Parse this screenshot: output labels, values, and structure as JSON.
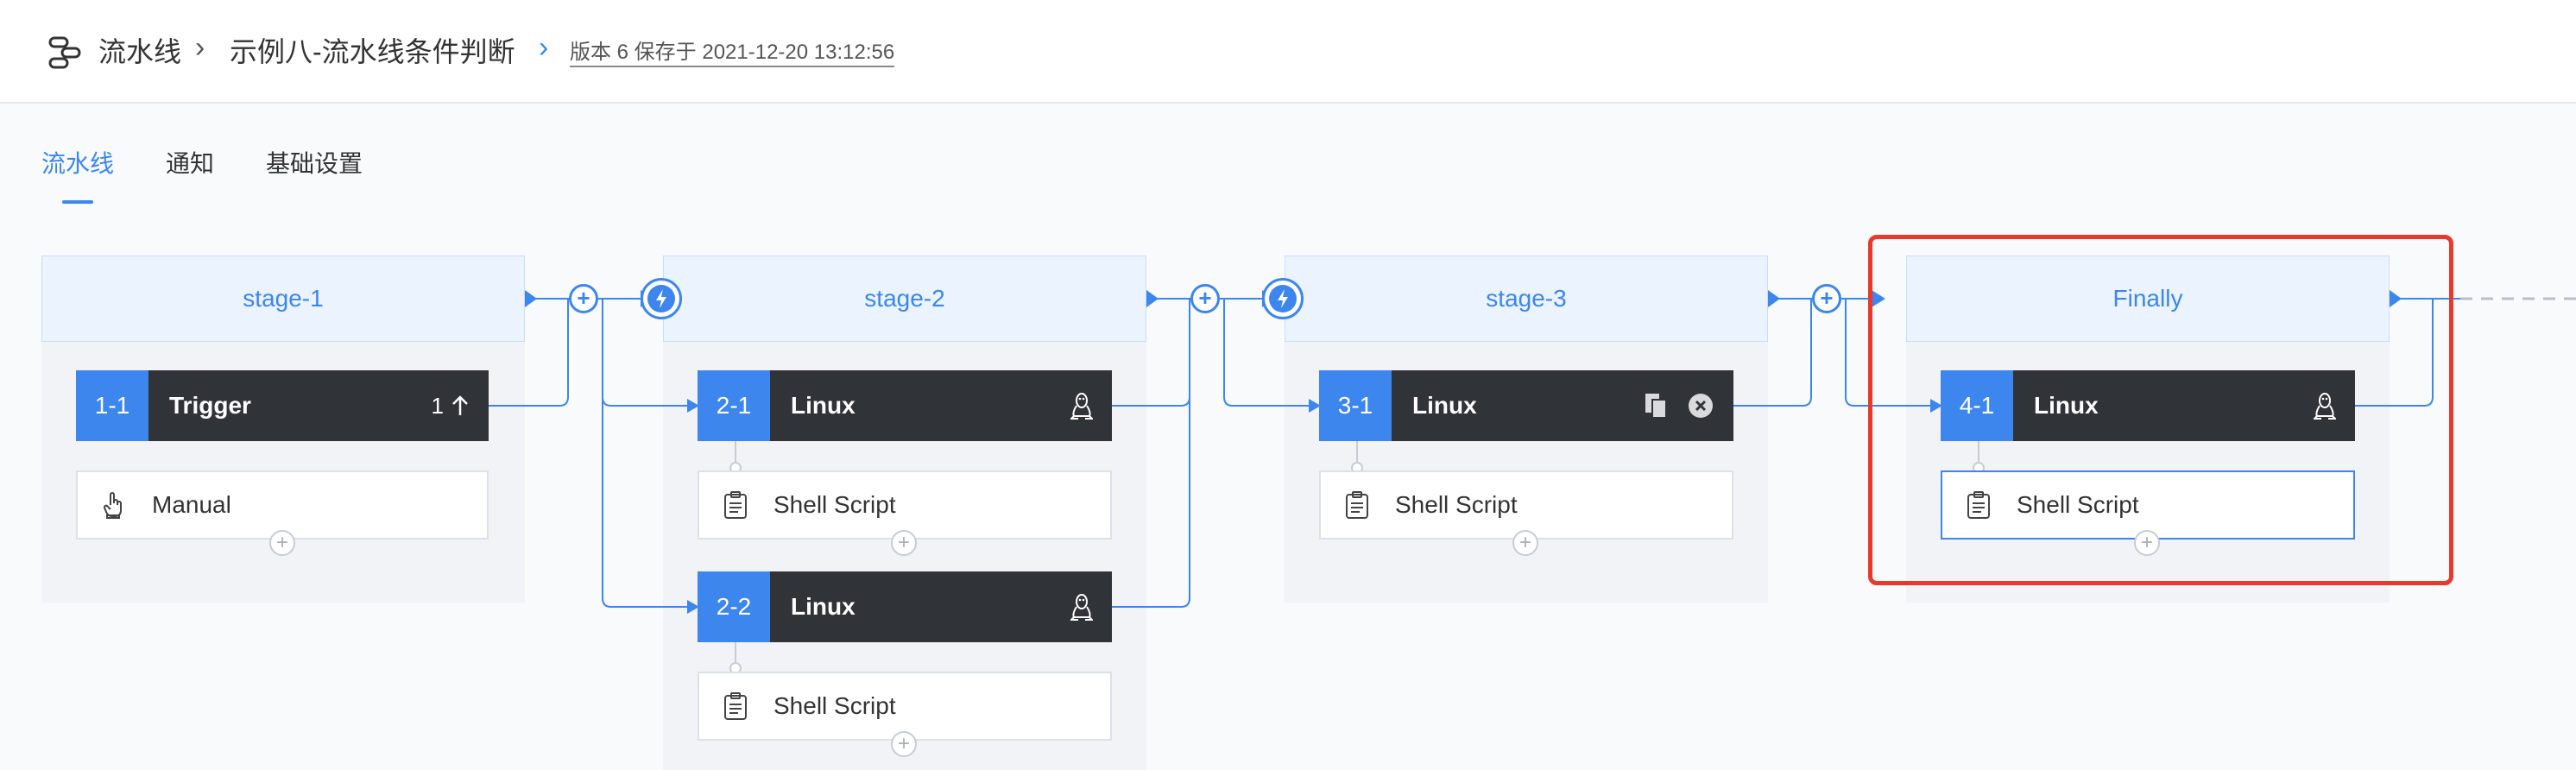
{
  "header": {
    "pipeline_label": "流水线",
    "pipeline_name": "示例八-流水线条件判断",
    "version_text": "版本 6 保存于 2021-12-20 13:12:56"
  },
  "tabs": [
    {
      "label": "流水线",
      "active": true
    },
    {
      "label": "通知",
      "active": false
    },
    {
      "label": "基础设置",
      "active": false
    }
  ],
  "stages": [
    {
      "name": "stage-1",
      "jobs": [
        {
          "id": "1-1",
          "name": "Trigger",
          "run_count": "1",
          "icon": "arrow-up-icon",
          "steps": [
            {
              "name": "Manual",
              "icon": "hand-pointer-icon"
            }
          ]
        }
      ]
    },
    {
      "name": "stage-2",
      "jobs": [
        {
          "id": "2-1",
          "name": "Linux",
          "icon": "linux-tux-icon",
          "steps": [
            {
              "name": "Shell Script",
              "icon": "clipboard-icon"
            }
          ]
        },
        {
          "id": "2-2",
          "name": "Linux",
          "icon": "linux-tux-icon",
          "steps": [
            {
              "name": "Shell Script",
              "icon": "clipboard-icon"
            }
          ]
        }
      ]
    },
    {
      "name": "stage-3",
      "jobs": [
        {
          "id": "3-1",
          "name": "Linux",
          "icons": [
            "copy-icon",
            "close-circle-icon"
          ],
          "steps": [
            {
              "name": "Shell Script",
              "icon": "clipboard-icon"
            }
          ]
        }
      ]
    },
    {
      "name": "Finally",
      "jobs": [
        {
          "id": "4-1",
          "name": "Linux",
          "icon": "linux-tux-icon",
          "steps": [
            {
              "name": "Shell Script",
              "icon": "clipboard-icon",
              "selected": true
            }
          ]
        }
      ]
    }
  ],
  "colors": {
    "accent": "#3c86ee",
    "job_dark": "#303338",
    "highlight": "#e8392c",
    "stage_head_bg": "#eaf3fe"
  }
}
